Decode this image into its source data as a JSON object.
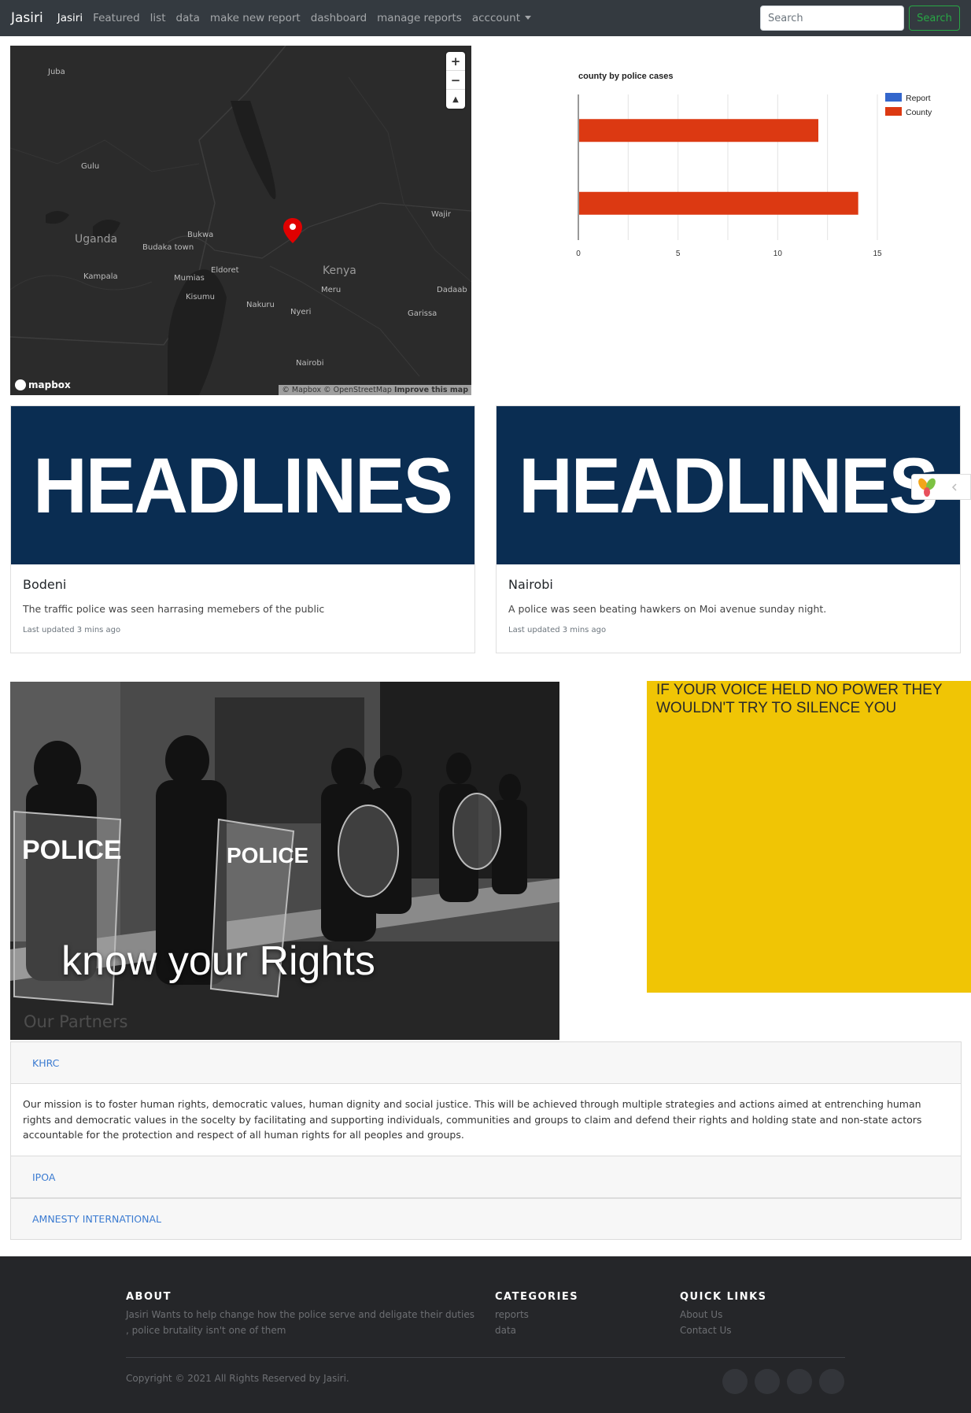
{
  "navbar": {
    "brand": "Jasiri",
    "links": [
      "Jasiri",
      "Featured",
      "list",
      "data",
      "make new report",
      "dashboard",
      "manage reports",
      "acccount"
    ],
    "search_placeholder": "Search",
    "search_button": "Search"
  },
  "map": {
    "labels": [
      "Juba",
      "Gulu",
      "Uganda",
      "Bukwa",
      "Budaka town",
      "Kampala",
      "Mumias",
      "Eldoret",
      "Kisumu",
      "Nakuru",
      "Nyeri",
      "Kenya",
      "Meru",
      "Wajir",
      "Dadaab",
      "Garissa",
      "Nairobi"
    ],
    "zoom_in": "+",
    "zoom_out": "−",
    "compass": "▲",
    "logo": "mapbox",
    "attribution": "© Mapbox © OpenStreetMap",
    "improve": "Improve this map"
  },
  "chart_data": {
    "type": "bar",
    "orientation": "horizontal",
    "title": "county by police cases",
    "categories": [
      "",
      ""
    ],
    "series": [
      {
        "name": "Report",
        "color": "#3366cc",
        "values": [
          0,
          0
        ]
      },
      {
        "name": "County",
        "color": "#dc3912",
        "values": [
          12,
          14
        ]
      }
    ],
    "xlim": [
      0,
      15
    ],
    "xticks": [
      "0",
      "5",
      "10",
      "15"
    ],
    "grid": true,
    "legend": "top-right"
  },
  "cards": [
    {
      "image_text": "HEADLINES",
      "title": "Bodeni",
      "text": "The traffic police was seen harrasing memebers of the public",
      "meta": "Last updated 3 mins ago"
    },
    {
      "image_text": "HEADLINES",
      "title": "Nairobi",
      "text": "A police was seen beating hawkers on Moi avenue sunday night.",
      "meta": "Last updated 3 mins ago"
    }
  ],
  "rights": {
    "title": "know your Rights",
    "partners_ghost": "Our Partners"
  },
  "quote": {
    "text": "IF YOUR VOICE HELD NO POWER THEY WOULDN'T TRY TO SILENCE YOU"
  },
  "partners": [
    {
      "name": "KHRC",
      "body": "Our mission is to foster human rights, democratic values, human dignity and social justice. This will be achieved through multiple strategies and actions aimed at entrenching human rights and democratic values in the socelty by facilitating and supporting individuals, communities and groups to claim and defend their rights and holding state and non-state actors accountable for the protection and respect of all human rights for all peoples and groups."
    },
    {
      "name": "IPOA"
    },
    {
      "name": "AMNESTY INTERNATIONAL"
    }
  ],
  "footer": {
    "about_title": "ABOUT",
    "about_text": "Jasiri Wants to help change how the police serve and deligate their duties , police brutality isn't one of them",
    "categories_title": "CATEGORIES",
    "categories": [
      "reports",
      "data"
    ],
    "links_title": "QUICK LINKS",
    "links": [
      "About Us",
      "Contact Us"
    ],
    "copyright": "Copyright © 2021 All Rights Reserved by Jasiri."
  },
  "colors": {
    "navbar": "#343a40",
    "headline_bg": "#0a2d52",
    "quote_bg": "#f0c505",
    "link": "#3b7bd1",
    "footer": "#252629"
  }
}
